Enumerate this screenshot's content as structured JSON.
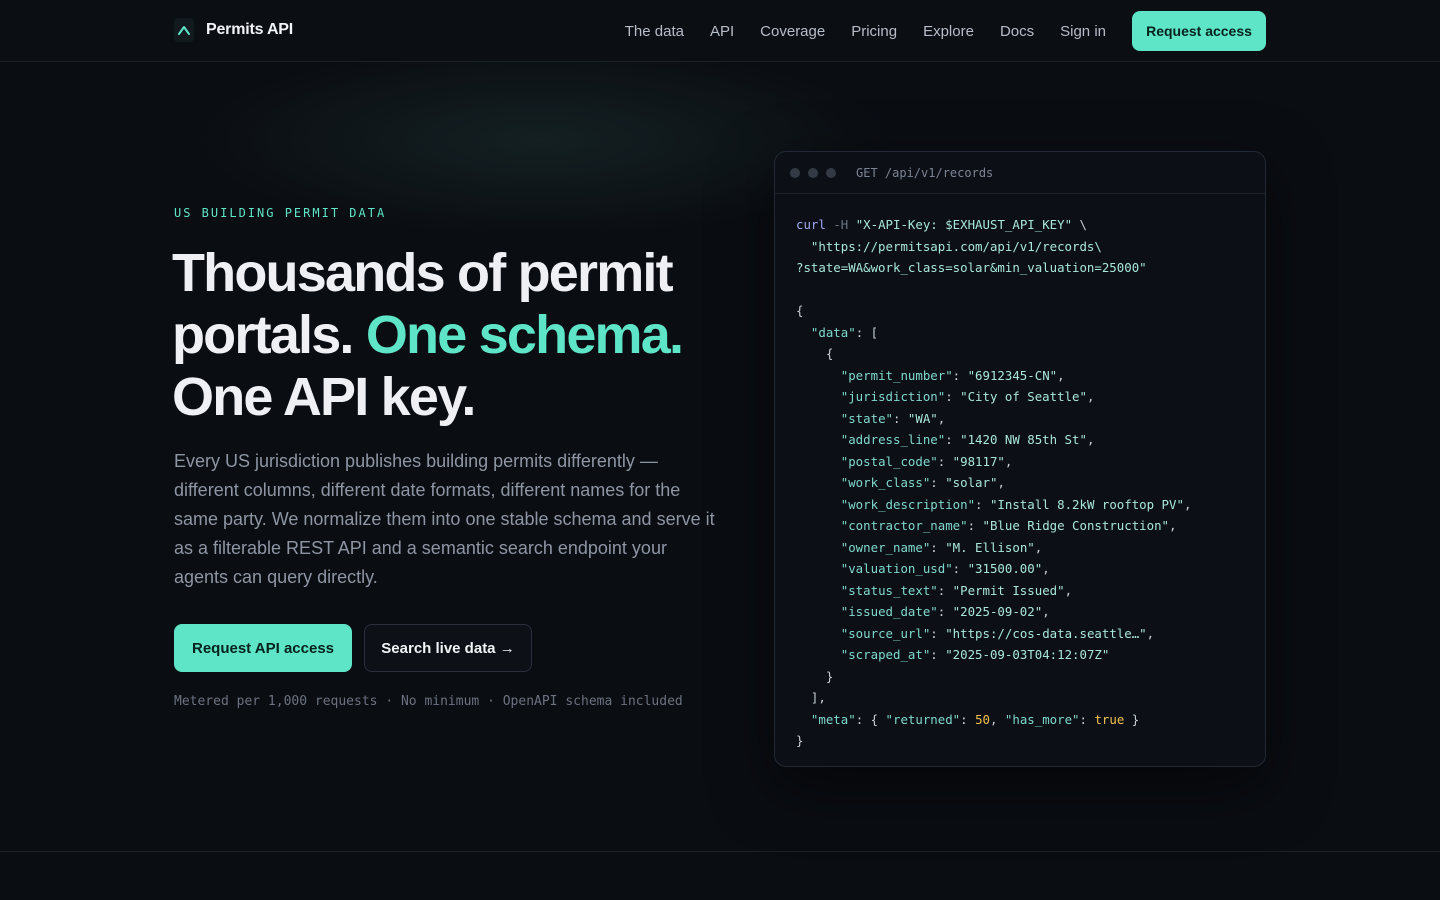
{
  "nav": {
    "brand": "Permits API",
    "links": [
      "The data",
      "API",
      "Coverage",
      "Pricing",
      "Explore",
      "Docs",
      "Sign in"
    ],
    "cta": "Request access"
  },
  "hero": {
    "eyebrow": "US BUILDING PERMIT DATA",
    "headline_1": "Thousands of permit",
    "headline_2a": "portals.",
    "headline_2b": "One schema.",
    "headline_3": "One API key.",
    "lede": "Every US jurisdiction publishes building permits differently — different columns, different date formats, different names for the same party. We normalize them into one stable schema and serve it as a filterable REST API and a semantic search endpoint your agents can query directly.",
    "primary_cta": "Request API access",
    "secondary_cta": "Search live data →",
    "fineprint": "Metered per 1,000 requests · No minimum · OpenAPI schema included"
  },
  "code_card": {
    "title": "GET /api/v1/records",
    "request": {
      "cmd": "curl",
      "flag": "-H",
      "header": "\"X-API-Key: $EXHAUST_API_KEY\"",
      "cont": "\\",
      "url_1": "\"https://permitsapi.com/api/v1/records\\",
      "url_2": "?state=WA&work_class=solar&min_valuation=25000\""
    },
    "fields": [
      {
        "key": "\"permit_number\"",
        "value": "\"6912345-CN\""
      },
      {
        "key": "\"jurisdiction\"",
        "value": "\"City of Seattle\""
      },
      {
        "key": "\"state\"",
        "value": "\"WA\""
      },
      {
        "key": "\"address_line\"",
        "value": "\"1420 NW 85th St\""
      },
      {
        "key": "\"postal_code\"",
        "value": "\"98117\""
      },
      {
        "key": "\"work_class\"",
        "value": "\"solar\""
      },
      {
        "key": "\"work_description\"",
        "value": "\"Install 8.2kW rooftop PV\""
      },
      {
        "key": "\"contractor_name\"",
        "value": "\"Blue Ridge Construction\""
      },
      {
        "key": "\"owner_name\"",
        "value": "\"M. Ellison\""
      },
      {
        "key": "\"valuation_usd\"",
        "value": "\"31500.00\""
      },
      {
        "key": "\"status_text\"",
        "value": "\"Permit Issued\""
      },
      {
        "key": "\"issued_date\"",
        "value": "\"2025-09-02\""
      },
      {
        "key": "\"source_url\"",
        "value": "\"https://cos-data.seattle…\""
      },
      {
        "key": "\"scraped_at\"",
        "value": "\"2025-09-03T04:12:07Z\""
      }
    ],
    "data_key": "\"data\"",
    "meta_key": "\"meta\"",
    "returned_key": "\"returned\"",
    "returned_value": "50",
    "has_more_key": "\"has_more\"",
    "has_more_value": "true"
  },
  "colors": {
    "accent": "#5ee4c7",
    "background": "#0a0d12"
  },
  "icons": {
    "logo": "caret-up-logo-icon"
  }
}
